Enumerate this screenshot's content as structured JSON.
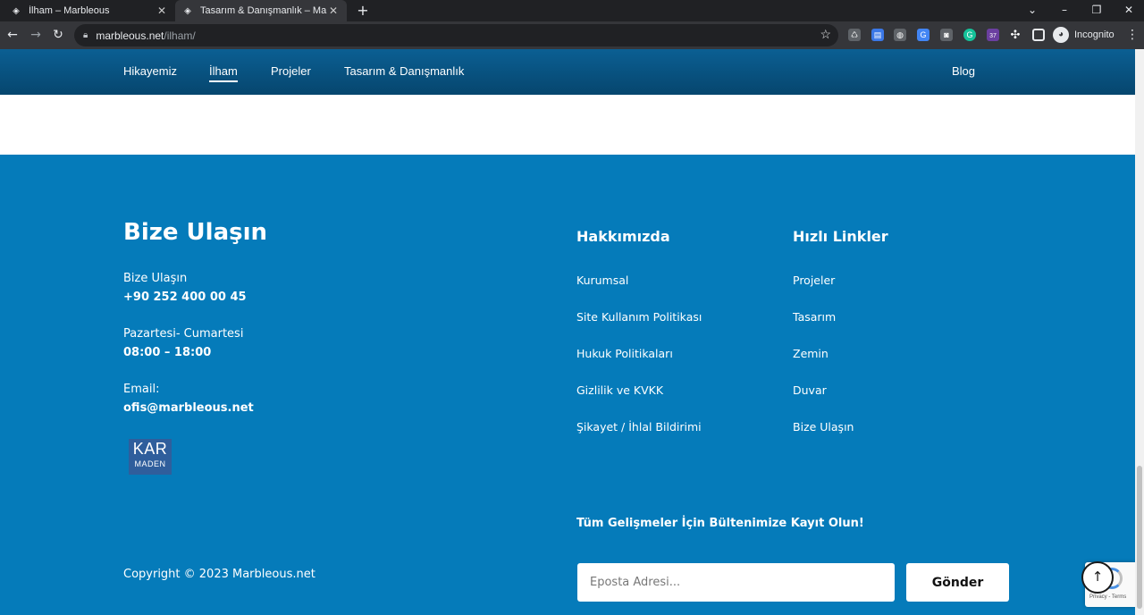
{
  "browser": {
    "tabs": [
      {
        "title": "İlham – Marbleous",
        "close": "✕"
      },
      {
        "title": "Tasarım & Danışmanlık – Marbleous",
        "close": "✕"
      }
    ],
    "new_tab": "+",
    "window_controls": {
      "minimize": "–",
      "restore": "❐",
      "close": "✕",
      "tablist": "⌄"
    },
    "url_host": "marbleous.net",
    "url_path": "/ilham/",
    "incognito_label": "Incognito",
    "extension_badge": "37"
  },
  "site_nav": {
    "items": [
      {
        "label": "Hikayemiz"
      },
      {
        "label": "İlham"
      },
      {
        "label": "Projeler"
      },
      {
        "label": "Tasarım & Danışmanlık"
      },
      {
        "label": "Blog"
      }
    ]
  },
  "footer": {
    "heading": "Bize Ulaşın",
    "contact": {
      "phone_label": "Bize Ulaşın",
      "phone": "+90 252 400 00 45",
      "hours_label": "Pazartesi- Cumartesi",
      "hours": "08:00 – 18:00",
      "email_label": "Email:",
      "email": "ofis@marbleous.net"
    },
    "logo": {
      "line1": "KAR",
      "line2": "MADEN"
    },
    "about": {
      "title": "Hakkımızda",
      "links": [
        "Kurumsal",
        "Site Kullanım Politikası",
        "Hukuk Politikaları",
        "Gizlilik ve KVKK",
        "Şikayet / İhlal Bildirimi"
      ]
    },
    "quick_links": {
      "title": "Hızlı Linkler",
      "links": [
        "Projeler",
        "Tasarım",
        "Zemin",
        "Duvar",
        "Bize Ulaşın"
      ]
    },
    "newsletter_title": "Tüm Gelişmeler İçin Bültenimize Kayıt Olun!",
    "email_placeholder": "Eposta Adresi...",
    "submit_label": "Gönder",
    "copyright": "Copyright © 2023 Marbleous.net",
    "recaptcha_text": "Privacy - Terms"
  },
  "colors": {
    "footer_bg": "#057bba",
    "nav_bg": "#0b5f93",
    "chrome_bg": "#35363a"
  }
}
